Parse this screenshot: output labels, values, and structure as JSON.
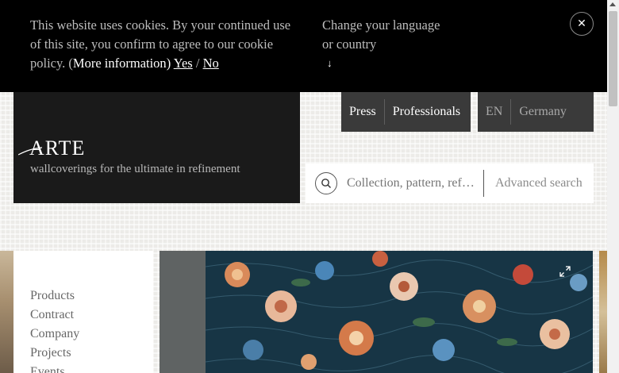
{
  "cookie": {
    "text": "This website uses cookies. By your continued use of this site, you confirm to agree to our cookie policy. (",
    "more_info": "More information",
    "close_paren": ") ",
    "yes": "Yes",
    "sep": " / ",
    "no": "No",
    "change_language": "Change your language or country",
    "arrow": "↓",
    "close": "✕"
  },
  "brand": {
    "logo_text": "ARTE",
    "tagline": "wallcoverings for the ultimate in refinement"
  },
  "header": {
    "press": "Press",
    "professionals": "Professionals",
    "language": "EN",
    "country": "Germany"
  },
  "search": {
    "placeholder": "Collection, pattern, reference...",
    "advanced": "Advanced search"
  },
  "nav": {
    "items": [
      "Products",
      "Contract",
      "Company",
      "Projects",
      "Events"
    ]
  },
  "colors": {
    "cookie_bg": "#000000",
    "logo_bg": "#1a1a1a",
    "button_bg": "#3a3a3a"
  },
  "icons": {
    "search": "search-icon",
    "close": "close-icon",
    "expand": "expand-icon"
  }
}
